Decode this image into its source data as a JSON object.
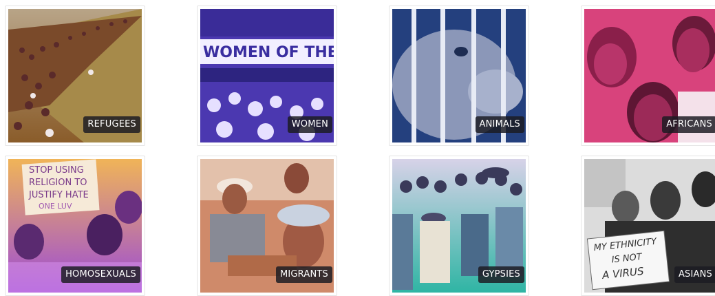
{
  "categories": [
    {
      "label": "REFUGEES"
    },
    {
      "label": "WOMEN"
    },
    {
      "label": "ANIMALS"
    },
    {
      "label": "AFRICANS"
    },
    {
      "label": "HOMOSEXUALS"
    },
    {
      "label": "MIGRANTS"
    },
    {
      "label": "GYPSIES"
    },
    {
      "label": "ASIANS"
    }
  ],
  "signs": {
    "women_banner": "WOMEN OF THE W",
    "religion_sign_1": "STOP USING",
    "religion_sign_2": "RELIGION TO",
    "religion_sign_3": "JUSTIFY HATE",
    "religion_sign_4": "ONE LUV",
    "virus_sign_1": "MY ETHNICITY",
    "virus_sign_2": "IS NOT",
    "virus_sign_3": "A VIRUS"
  },
  "colors": {
    "refugees_tint": "#c98a3c",
    "women_tint": "#5a3fb8",
    "animals_tint": "#2e4a8c",
    "africans_tint": "#d6437a",
    "homosexuals_tint": "#b05ad8",
    "migrants_tint": "#c9795a",
    "gypsies_tint": "#3bb8a8",
    "asians_tint": "#8a8a8a",
    "label_bg": "#1c1c22"
  }
}
